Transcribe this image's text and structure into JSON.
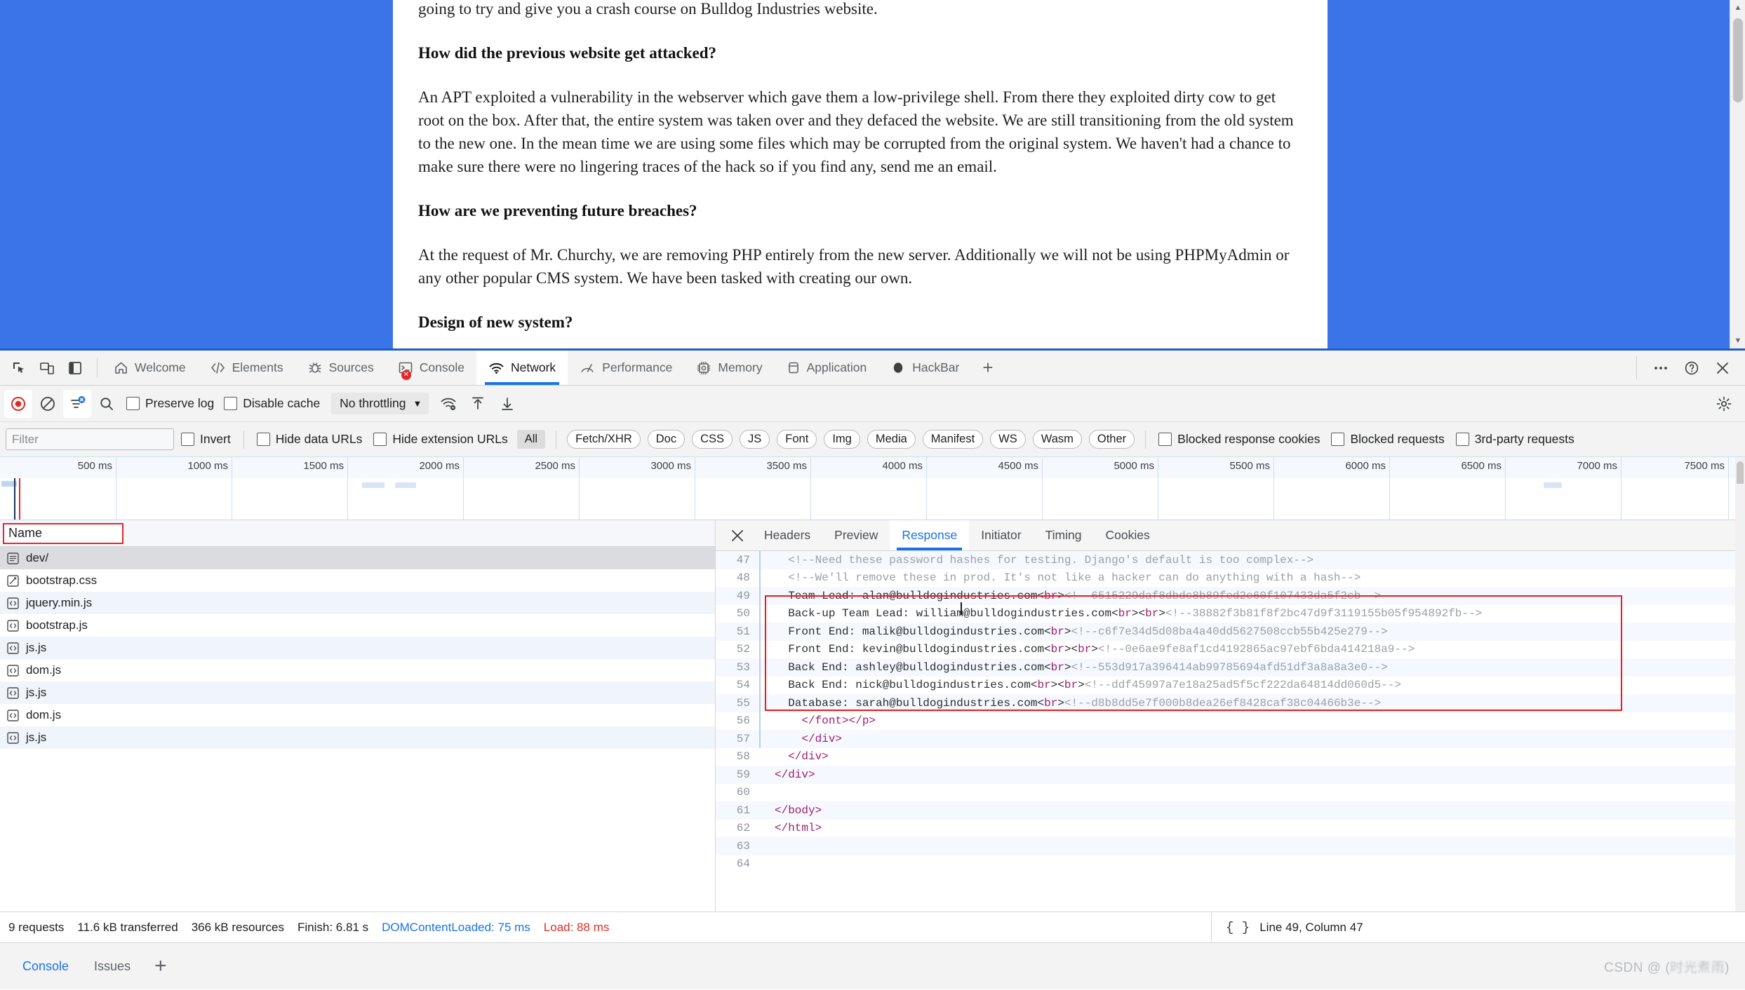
{
  "page": {
    "blocks": [
      {
        "type": "para",
        "text": "going to try and give you a crash course on Bulldog Industries website."
      },
      {
        "type": "head",
        "text": "How did the previous website get attacked?"
      },
      {
        "type": "para",
        "text": "An APT exploited a vulnerability in the webserver which gave them a low-privilege shell. From there they exploited dirty cow to get root on the box. After that, the entire system was taken over and they defaced the website. We are still transitioning from the old system to the new one. In the mean time we are using some files which may be corrupted from the original system. We haven't had a chance to make sure there were no lingering traces of the hack so if you find any, send me an email."
      },
      {
        "type": "head",
        "text": "How are we preventing future breaches?"
      },
      {
        "type": "para",
        "text": "At the request of Mr. Churchy, we are removing PHP entirely from the new server. Additionally we will not be using PHPMyAdmin or any other popular CMS system. We have been tasked with creating our own."
      },
      {
        "type": "head",
        "text": "Design of new system?"
      }
    ]
  },
  "devtools": {
    "dock_buttons": [
      "inspect-element-icon",
      "device-toolbar-icon",
      "dock-side-icon"
    ],
    "tabs": [
      {
        "label": "Welcome",
        "icon": "home-icon",
        "active": false
      },
      {
        "label": "Elements",
        "icon": "code-brackets-icon",
        "active": false
      },
      {
        "label": "Sources",
        "icon": "bug-icon",
        "active": false
      },
      {
        "label": "Console",
        "icon": "console-prompt-icon",
        "active": false,
        "error_badge": true
      },
      {
        "label": "Network",
        "icon": "network-wifi-icon",
        "active": true
      },
      {
        "label": "Performance",
        "icon": "performance-needle-icon",
        "active": false
      },
      {
        "label": "Memory",
        "icon": "memory-chip-icon",
        "active": false
      },
      {
        "label": "Application",
        "icon": "database-icon",
        "active": false
      },
      {
        "label": "HackBar",
        "icon": "hackbar-circle-icon",
        "active": false
      }
    ],
    "add_tab_label": "+",
    "right_buttons": [
      {
        "label": "…",
        "name": "more-options-icon"
      },
      {
        "label": "?",
        "name": "help-icon"
      },
      {
        "label": "✕",
        "name": "close-devtools-icon"
      }
    ]
  },
  "network_toolbar": {
    "record_title": "record-button",
    "clear_title": "clear-button",
    "filter_toggle_title": "filter-toggle-button",
    "search_title": "search-button",
    "preserve_log": {
      "label": "Preserve log",
      "checked": false
    },
    "disable_cache": {
      "label": "Disable cache",
      "checked": false
    },
    "throttling": {
      "value": "No throttling",
      "caret": "▼"
    },
    "extra_icons": [
      "network-conditions-icon",
      "import-har-icon",
      "export-har-icon"
    ],
    "settings_icon": "gear-icon"
  },
  "filter_bar": {
    "filter_placeholder": "Filter",
    "filter_value": "",
    "invert": {
      "label": "Invert",
      "checked": false
    },
    "hide_data_urls": {
      "label": "Hide data URLs",
      "checked": false
    },
    "hide_extension_urls": {
      "label": "Hide extension URLs",
      "checked": false
    },
    "types": [
      "All",
      "Fetch/XHR",
      "Doc",
      "CSS",
      "JS",
      "Font",
      "Img",
      "Media",
      "Manifest",
      "WS",
      "Wasm",
      "Other"
    ],
    "active_type": "All",
    "blocked_response_cookies": {
      "label": "Blocked response cookies",
      "checked": false
    },
    "blocked_requests": {
      "label": "Blocked requests",
      "checked": false
    },
    "third_party_requests": {
      "label": "3rd-party requests",
      "checked": false
    }
  },
  "overview": {
    "ticks": [
      "500 ms",
      "1000 ms",
      "1500 ms",
      "2000 ms",
      "2500 ms",
      "3000 ms",
      "3500 ms",
      "4000 ms",
      "4500 ms",
      "5000 ms",
      "5500 ms",
      "6000 ms",
      "6500 ms",
      "7000 ms",
      "7500 ms"
    ]
  },
  "request_list": {
    "column_header": "Name",
    "rows": [
      {
        "name": "dev/",
        "icon": "document-icon",
        "selected": true
      },
      {
        "name": "bootstrap.css",
        "icon": "stylesheet-icon",
        "selected": false
      },
      {
        "name": "jquery.min.js",
        "icon": "script-icon",
        "selected": false
      },
      {
        "name": "bootstrap.js",
        "icon": "script-icon",
        "selected": false
      },
      {
        "name": "js.js",
        "icon": "script-icon",
        "selected": false
      },
      {
        "name": "dom.js",
        "icon": "script-icon",
        "selected": false
      },
      {
        "name": "js.js",
        "icon": "script-icon",
        "selected": false
      },
      {
        "name": "dom.js",
        "icon": "script-icon",
        "selected": false
      },
      {
        "name": "js.js",
        "icon": "script-icon",
        "selected": false
      }
    ]
  },
  "detail_panel": {
    "close_label": "✕",
    "tabs": [
      "Headers",
      "Preview",
      "Response",
      "Initiator",
      "Timing",
      "Cookies"
    ],
    "active_tab": "Response",
    "code_lines": [
      {
        "n": 47,
        "text": "  <!--Need these password hashes for testing. Django's default is too complex-->",
        "kind": "comment"
      },
      {
        "n": 48,
        "text": "  <!--We'll remove these in prod. It's not like a hacker can do anything with a hash-->",
        "kind": "comment"
      },
      {
        "n": 49,
        "text": "  Team Lead: alan@bulldogindustries.com<br><!--6515229daf8dbdc8b89fed2e60f107433da5f2cb-->",
        "kind": "mixed",
        "highlighted": true
      },
      {
        "n": 50,
        "text": "  Back-up Team Lead: william@bulldogindustries.com<br><br><!--38882f3b81f8f2bc47d9f3119155b05f954892fb-->",
        "kind": "mixed",
        "highlighted": true
      },
      {
        "n": 51,
        "text": "  Front End: malik@bulldogindustries.com<br><!--c6f7e34d5d08ba4a40dd5627508ccb55b425e279-->",
        "kind": "mixed",
        "highlighted": true
      },
      {
        "n": 52,
        "text": "  Front End: kevin@bulldogindustries.com<br><br><!--0e6ae9fe8af1cd4192865ac97ebf6bda414218a9-->",
        "kind": "mixed",
        "highlighted": true
      },
      {
        "n": 53,
        "text": "  Back End: ashley@bulldogindustries.com<br><!--553d917a396414ab99785694afd51df3a8a8a3e0-->",
        "kind": "mixed",
        "highlighted": true
      },
      {
        "n": 54,
        "text": "  Back End: nick@bulldogindustries.com<br><br><!--ddf45997a7e18a25ad5f5cf222da64814dd060d5-->",
        "kind": "mixed",
        "highlighted": true
      },
      {
        "n": 55,
        "text": "  Database: sarah@bulldogindustries.com<br><!--d8b8dd5e7f000b8dea26ef8428caf38c04466b3e-->",
        "kind": "mixed",
        "highlighted": true
      },
      {
        "n": 56,
        "text": "    </font></p>",
        "kind": "tag"
      },
      {
        "n": 57,
        "text": "    </div>",
        "kind": "tag"
      },
      {
        "n": 58,
        "text": "  </div>",
        "kind": "tag"
      },
      {
        "n": 59,
        "text": "</div>",
        "kind": "tag"
      },
      {
        "n": 60,
        "text": "",
        "kind": "blank"
      },
      {
        "n": 61,
        "text": "</body>",
        "kind": "tag"
      },
      {
        "n": 62,
        "text": "</html>",
        "kind": "tag"
      },
      {
        "n": 63,
        "text": "",
        "kind": "blank"
      },
      {
        "n": 64,
        "text": "",
        "kind": "blank"
      }
    ]
  },
  "status_bar": {
    "requests": "9 requests",
    "transferred": "11.6 kB transferred",
    "resources": "366 kB resources",
    "finish": "Finish: 6.81 s",
    "dom_content_loaded": "DOMContentLoaded: 75 ms",
    "load": "Load: 88 ms",
    "format_icon": "{ }",
    "cursor_position": "Line 49, Column 47"
  },
  "drawer": {
    "tabs": [
      "Console",
      "Issues"
    ],
    "active_tab": "Console",
    "add_label": "+"
  },
  "watermark": {
    "prefix": "CSDN @ (",
    "blurred": "时光煮雨",
    "suffix": ")"
  },
  "colors": {
    "accent_blue": "#1a73e8",
    "highlight_red": "#ee1b1b",
    "error_red": "#d93025",
    "page_blue": "#3b74e8",
    "comment_gray": "#9aa0a6",
    "tag_magenta": "#a01e6e"
  }
}
